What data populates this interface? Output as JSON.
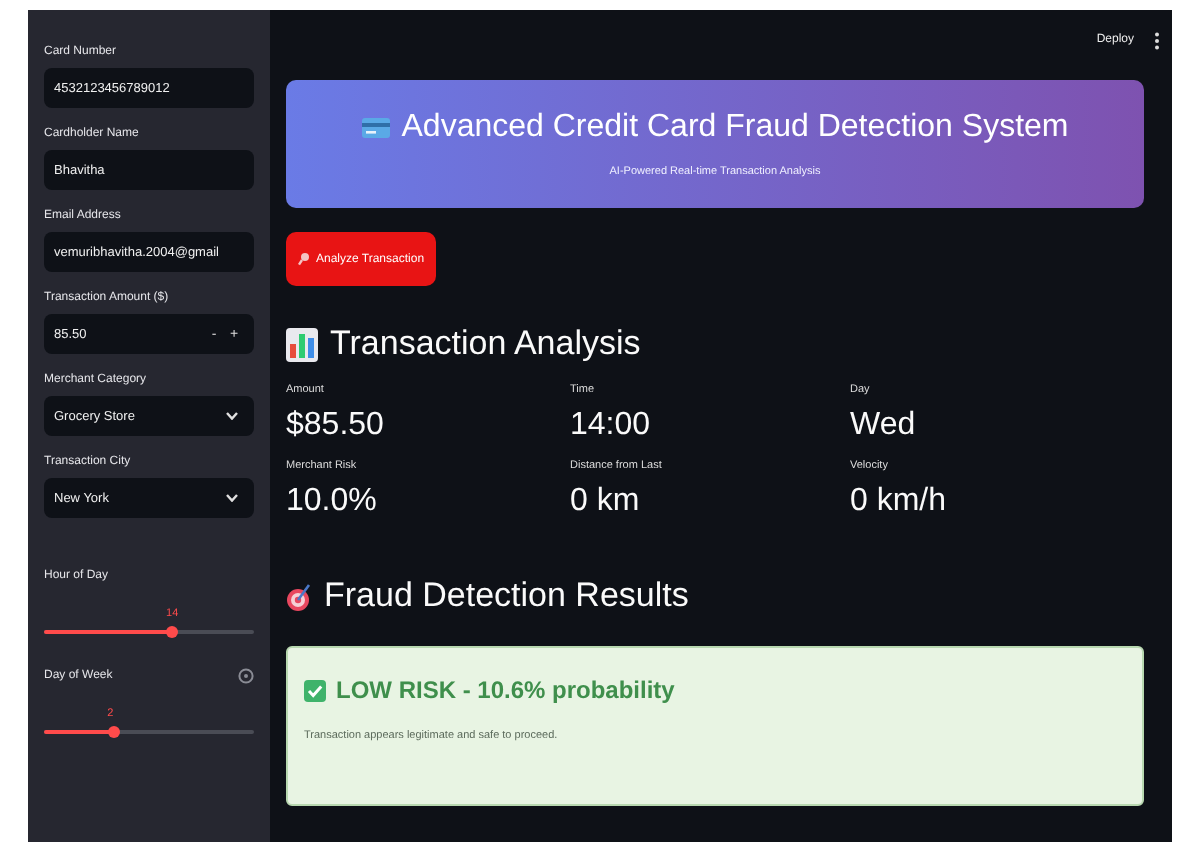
{
  "sidebar": {
    "fields": [
      {
        "kind": "text",
        "label": "Card Number",
        "value": "4532123456789012"
      },
      {
        "kind": "text",
        "label": "Cardholder Name",
        "value": "Bhavitha"
      },
      {
        "kind": "text",
        "label": "Email Address",
        "value": "vemuribhavitha.2004@gmail"
      },
      {
        "kind": "number",
        "label": "Transaction Amount ($)",
        "value": "85.50",
        "minus": "-",
        "plus": "+"
      },
      {
        "kind": "select",
        "label": "Merchant Category",
        "value": "Grocery Store"
      },
      {
        "kind": "select",
        "label": "Transaction City",
        "value": "New York"
      },
      {
        "kind": "slider",
        "label": "Hour of Day",
        "value": "14",
        "level": 0.61,
        "help": false
      },
      {
        "kind": "slider",
        "label": "Day of Week",
        "value": "2",
        "level": 0.33,
        "help": true
      }
    ]
  },
  "toolbar": {
    "deploy": "Deploy"
  },
  "banner": {
    "title": "Advanced Credit Card Fraud Detection System",
    "subtitle": "AI-Powered Real-time Transaction Analysis"
  },
  "analyze_button": "Analyze Transaction",
  "analysis": {
    "heading": "Transaction Analysis",
    "metrics": [
      {
        "label": "Amount",
        "value": "$85.50"
      },
      {
        "label": "Time",
        "value": "14:00"
      },
      {
        "label": "Day",
        "value": "Wed"
      },
      {
        "label": "Merchant Risk",
        "value": "10.0%"
      },
      {
        "label": "Distance from Last",
        "value": "0 km"
      },
      {
        "label": "Velocity",
        "value": "0 km/h"
      }
    ]
  },
  "results": {
    "heading": "Fraud Detection Results",
    "kind": "low",
    "title": "LOW RISK - 10.6% probability",
    "message": "Transaction appears legitimate and safe to proceed."
  }
}
